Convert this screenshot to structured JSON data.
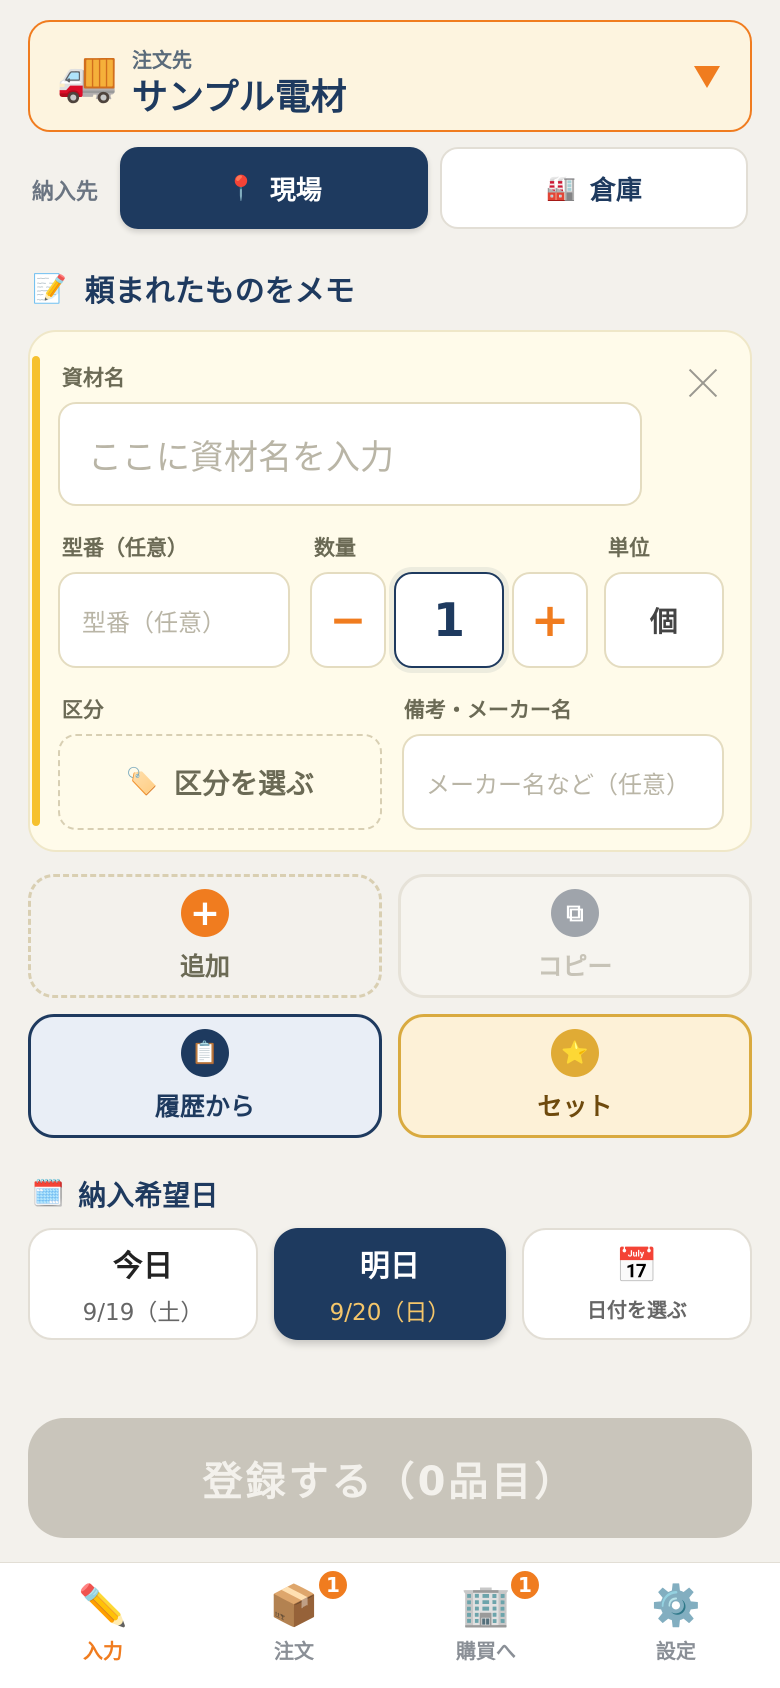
{
  "supplier": {
    "sub_label": "注文先",
    "name": "サンプル電材",
    "icon": "truck-icon"
  },
  "destination": {
    "label": "納入先",
    "options": [
      {
        "label": "現場",
        "icon": "pin-icon",
        "selected": true
      },
      {
        "label": "倉庫",
        "icon": "factory-icon",
        "selected": false
      }
    ]
  },
  "memo": {
    "heading": "頼まれたものをメモ",
    "icon": "memo-icon"
  },
  "item": {
    "name_label": "資材名",
    "name_placeholder": "ここに資材名を入力",
    "model_label": "型番（任意）",
    "model_placeholder": "型番（任意）",
    "qty_label": "数量",
    "qty_value": "1",
    "minus": "−",
    "plus": "+",
    "unit_label": "単位",
    "unit_value": "個",
    "category_label": "区分",
    "category_button": "区分を選ぶ",
    "notes_label": "備考・メーカー名",
    "notes_placeholder": "メーカー名など（任意）"
  },
  "actions": {
    "add": "追加",
    "copy": "コピー",
    "history": "履歴から",
    "set": "セット"
  },
  "date": {
    "heading": "納入希望日",
    "today_label": "今日",
    "today_date": "9/19（土）",
    "tomorrow_label": "明日",
    "tomorrow_date": "9/20（日）",
    "pick_label": "日付を選ぶ",
    "pick_icon_text": "17"
  },
  "submit": {
    "label": "登録する（0品目）"
  },
  "nav": {
    "items": [
      {
        "label": "入力",
        "icon": "pencil-icon",
        "active": true
      },
      {
        "label": "注文",
        "icon": "package-icon",
        "badge": "1"
      },
      {
        "label": "購買へ",
        "icon": "building-icon",
        "badge": "1"
      },
      {
        "label": "設定",
        "icon": "gear-icon"
      }
    ]
  },
  "colors": {
    "primary": "#1e3a5f",
    "accent": "#f07c1f",
    "card": "#fffbea",
    "stripe": "#f6c12f"
  }
}
